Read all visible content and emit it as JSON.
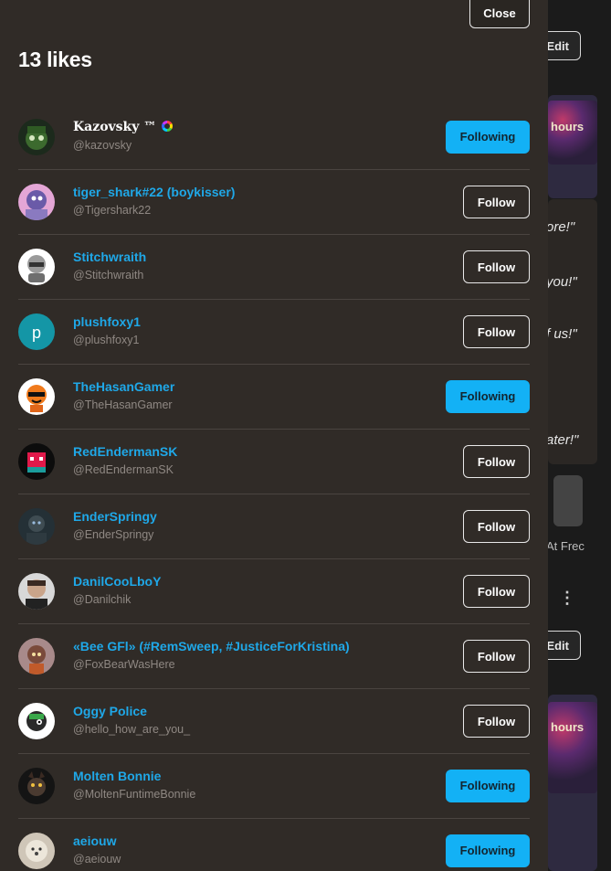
{
  "modal": {
    "close_label": "Close",
    "title": "13 likes"
  },
  "likes": [
    {
      "name": "Kazovsky ™",
      "handle": "@kazovsky",
      "button": "Following",
      "status": "following",
      "verified": true
    },
    {
      "name": "tiger_shark#22 (boykisser)",
      "handle": "@Tigershark22",
      "button": "Follow",
      "status": "follow"
    },
    {
      "name": "Stitchwraith",
      "handle": "@Stitchwraith",
      "button": "Follow",
      "status": "follow"
    },
    {
      "name": "plushfoxy1",
      "handle": "@plushfoxy1",
      "button": "Follow",
      "status": "follow",
      "avatar_letter": "p"
    },
    {
      "name": "TheHasanGamer",
      "handle": "@TheHasanGamer",
      "button": "Following",
      "status": "following"
    },
    {
      "name": "RedEndermanSK",
      "handle": "@RedEndermanSK",
      "button": "Follow",
      "status": "follow"
    },
    {
      "name": "EnderSpringy",
      "handle": "@EnderSpringy",
      "button": "Follow",
      "status": "follow"
    },
    {
      "name": "DanilCooLboY",
      "handle": "@Danilchik",
      "button": "Follow",
      "status": "follow"
    },
    {
      "name": "«Bee GFl» (#RemSweep, #JusticeForKristina)",
      "handle": "@FoxBearWasHere",
      "button": "Follow",
      "status": "follow"
    },
    {
      "name": "Oggy Police",
      "handle": "@hello_how_are_you_",
      "button": "Follow",
      "status": "follow"
    },
    {
      "name": "Molten Bonnie",
      "handle": "@MoltenFuntimeBonnie",
      "button": "Following",
      "status": "following"
    },
    {
      "name": "aeiouw",
      "handle": "@aeiouw",
      "button": "Following",
      "status": "following"
    }
  ],
  "background": {
    "edit_label": "Edit",
    "quotes": [
      "ore!\"",
      "you!\"",
      "f us!\"",
      "ater!\""
    ],
    "thumb_text": "hours",
    "caption": "At Frec"
  },
  "colors": {
    "modal_bg": "#302b27",
    "accent": "#13b1f5",
    "name_link": "#1fa8e8"
  }
}
